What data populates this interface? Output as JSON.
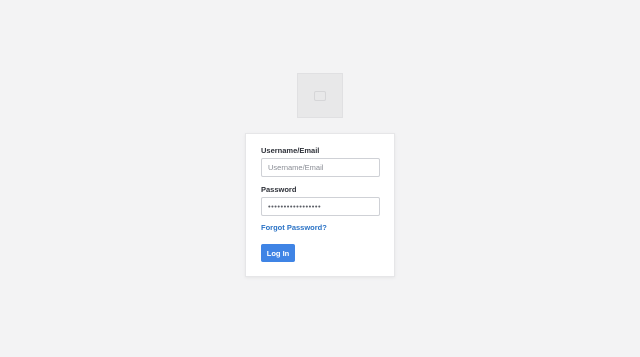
{
  "login": {
    "username_label": "Username/Email",
    "username_placeholder": "Username/Email",
    "password_label": "Password",
    "password_value": "•••••••••••••••••",
    "forgot_link": "Forgot Password?",
    "login_button": "Log In"
  },
  "colors": {
    "background": "#f3f3f4",
    "accent": "#3f84e5",
    "link": "#2b73c6"
  },
  "icons": {
    "logo": "image-placeholder-icon"
  }
}
